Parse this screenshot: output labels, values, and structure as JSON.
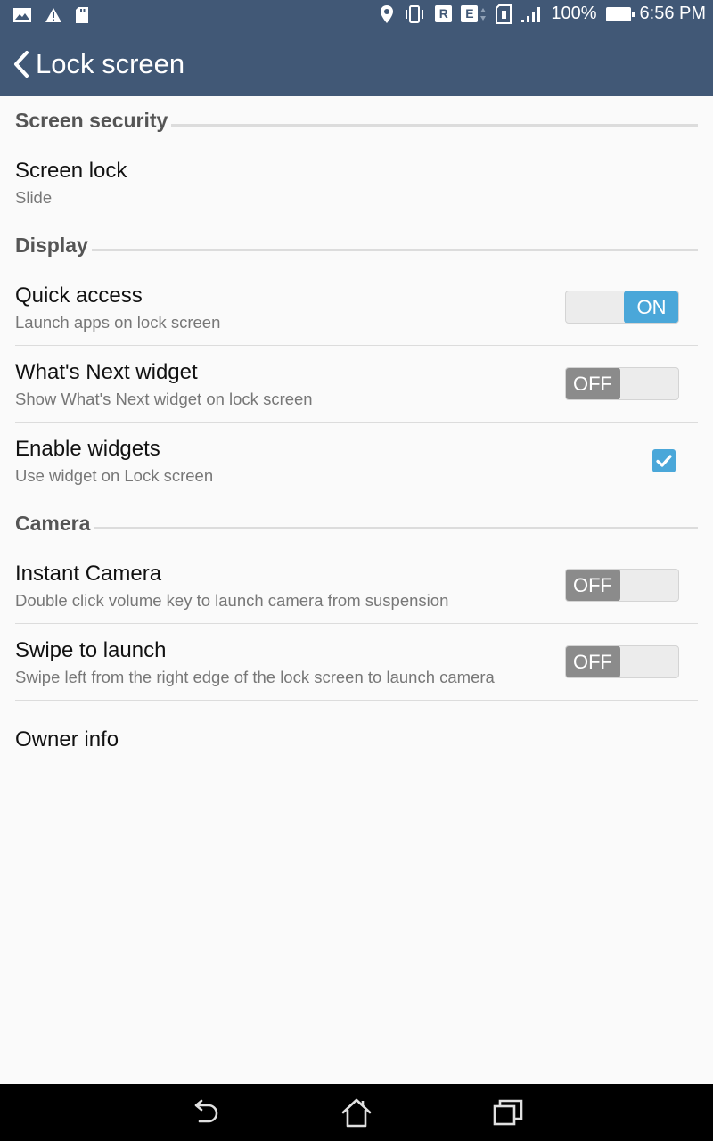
{
  "status_bar": {
    "left_icons": [
      "image-icon",
      "warning-icon",
      "sd-card-icon"
    ],
    "right_icons": [
      "location-icon",
      "vibrate-icon",
      "r-chip-icon",
      "e-chip-icon",
      "data-arrows-icon",
      "sim1-icon",
      "signal-icon",
      "battery-icon"
    ],
    "r_chip": "R",
    "e_chip": "E",
    "battery": "100%",
    "time": "6:56 PM"
  },
  "header": {
    "title": "Lock screen",
    "back_icon": "chevron-left-icon"
  },
  "sections": {
    "screen_security": "Screen security",
    "display": "Display",
    "camera": "Camera"
  },
  "items": {
    "screen_lock": {
      "title": "Screen lock",
      "summary": "Slide"
    },
    "quick_access": {
      "title": "Quick access",
      "summary": "Launch apps on lock screen",
      "toggle": "ON"
    },
    "whats_next": {
      "title": "What's Next widget",
      "summary": "Show What's Next widget on lock screen",
      "toggle": "OFF"
    },
    "enable_widgets": {
      "title": "Enable widgets",
      "summary": "Use widget on Lock screen",
      "checked": true
    },
    "instant_camera": {
      "title": "Instant Camera",
      "summary": "Double click volume key to launch camera from suspension",
      "toggle": "OFF"
    },
    "swipe_to_launch": {
      "title": "Swipe to launch",
      "summary": "Swipe left from the right edge of the lock screen to launch camera",
      "toggle": "OFF"
    },
    "owner_info": {
      "title": "Owner info"
    }
  },
  "nav_bar": {
    "icons": [
      "back-nav-icon",
      "home-nav-icon",
      "recents-nav-icon"
    ]
  },
  "colors": {
    "header_bg": "#415876",
    "accent": "#4aa7d9",
    "toggle_off": "#8b8b8b"
  }
}
